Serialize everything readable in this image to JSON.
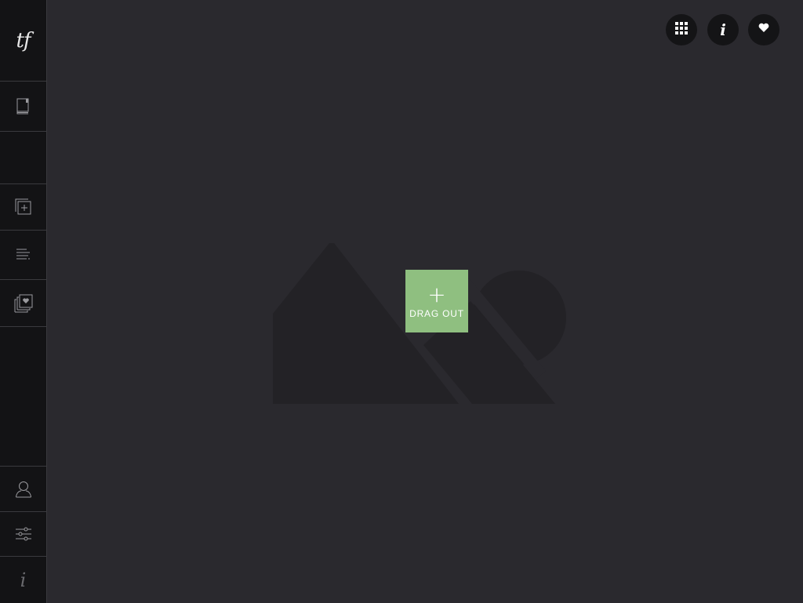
{
  "sidebar": {
    "logo": "tf",
    "items": [
      {
        "name": "book-icon"
      },
      {
        "name": "empty"
      },
      {
        "name": "add-layer-icon"
      },
      {
        "name": "text-align-icon"
      },
      {
        "name": "favorites-icon"
      },
      {
        "name": "user-icon"
      },
      {
        "name": "sliders-icon"
      },
      {
        "name": "info-icon"
      }
    ],
    "info_glyph": "i"
  },
  "toolbar": {
    "grid_icon": "grid-icon",
    "info_glyph": "i",
    "heart_icon": "heart-icon"
  },
  "canvas": {
    "drag_plus": "+",
    "drag_label": "DRAG OUT"
  },
  "colors": {
    "background": "#2a292e",
    "sidebar": "#131315",
    "accent": "#8fbf80",
    "placeholder_shape": "#232226"
  }
}
